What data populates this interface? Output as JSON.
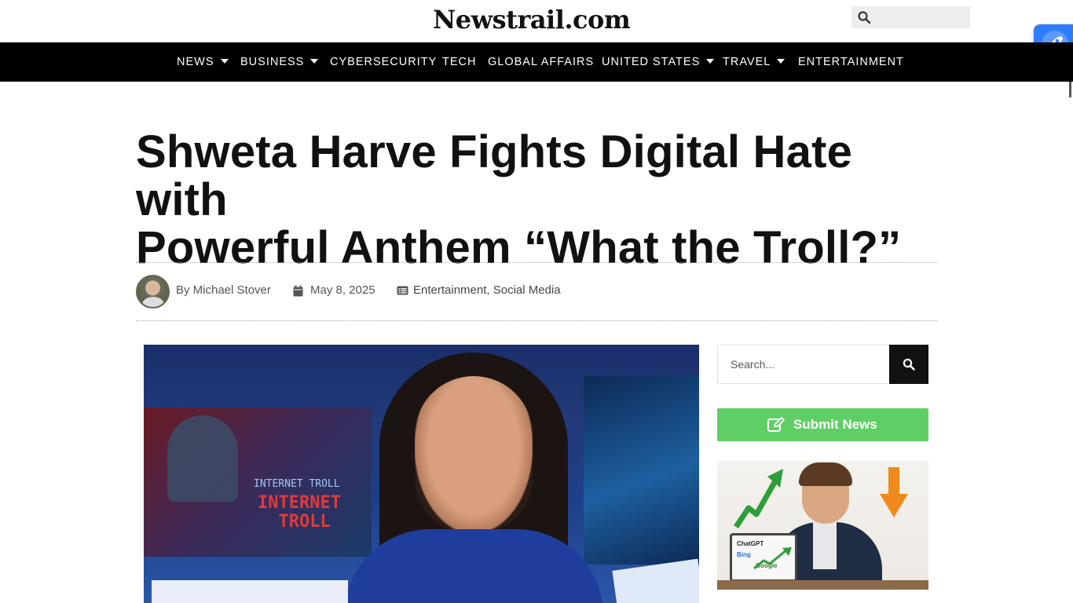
{
  "site": {
    "logo_text": "Newstrail.com",
    "search_placeholder": ""
  },
  "nav": {
    "items": [
      {
        "label": "NEWS",
        "has_dropdown": true
      },
      {
        "label": "BUSINESS",
        "has_dropdown": true
      },
      {
        "label": "CYBERSECURITY",
        "has_dropdown": false
      },
      {
        "label": "TECH",
        "has_dropdown": false
      },
      {
        "label": "GLOBAL AFFAIRS",
        "has_dropdown": false
      },
      {
        "label": "UNITED STATES",
        "has_dropdown": true
      },
      {
        "label": "TRAVEL",
        "has_dropdown": true
      },
      {
        "label": "ENTERTAINMENT",
        "has_dropdown": false
      }
    ]
  },
  "article": {
    "title_line1": "Shweta Harve Fights Digital Hate with",
    "title_line2": "Powerful Anthem “What the Troll?”",
    "author": "By Michael Stover",
    "date": "May 8, 2025",
    "category_1": "Entertainment",
    "category_sep": ",",
    "category_2": "Social Media",
    "image_overlay_text": {
      "small": "INTERNET TROLL",
      "large_1": "INTERNET",
      "large_2": "TROLL"
    }
  },
  "sidebar": {
    "search_placeholder": "Search...",
    "submit_news_label": "Submit News",
    "ad_labels": {
      "chatgpt": "ChatGPT",
      "bing": "Bing",
      "google": "Google"
    }
  },
  "colors": {
    "nav_bg": "#000000",
    "submit_green": "#5fcf65",
    "search_button": "#111111",
    "rocket_blue": "#2f7dff"
  },
  "icons": {
    "top_search": "search-icon",
    "rocket": "rocket-icon",
    "date": "calendar-icon",
    "categories": "list-icon",
    "submit": "edit-icon"
  }
}
